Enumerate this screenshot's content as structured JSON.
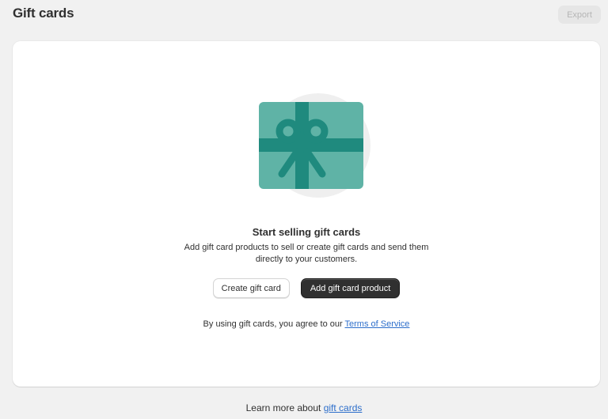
{
  "header": {
    "title": "Gift cards",
    "export_label": "Export"
  },
  "empty_state": {
    "illustration_icon": "gift-card-illustration",
    "title": "Start selling gift cards",
    "description": "Add gift card products to sell or create gift cards and send them directly to your customers.",
    "secondary_action_label": "Create gift card",
    "primary_action_label": "Add gift card product",
    "terms_prefix": "By using gift cards, you agree to our ",
    "terms_link": "Terms of Service"
  },
  "footer": {
    "learn_more_prefix": "Learn more about ",
    "learn_more_link": "gift cards"
  },
  "colors": {
    "page_background": "#f1f1f1",
    "card_background": "#ffffff",
    "primary_button": "#303030",
    "link": "#2c6ecb",
    "gift_card_teal": "#5fb3a6",
    "gift_ribbon_teal": "#1f8a7e"
  }
}
